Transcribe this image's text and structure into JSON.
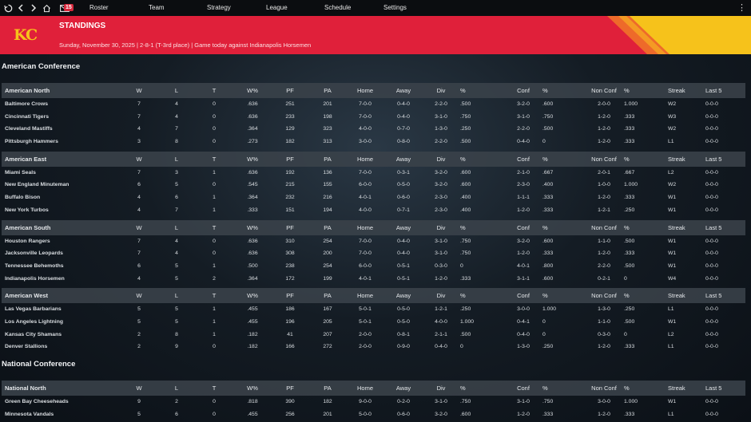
{
  "nav": {
    "mail_count": "15",
    "menu": [
      "Roster",
      "Team",
      "Strategy",
      "League",
      "Schedule",
      "Settings"
    ]
  },
  "header": {
    "logo_text": "KC",
    "title": "STANDINGS",
    "subtitle": "Sunday, November 30, 2025 | 2-8-1 (T-3rd place) | Game today against Indianapolis Horsemen",
    "colors": {
      "primary": "#e0203a",
      "accent": "#f6c21b"
    }
  },
  "columns": [
    "W",
    "L",
    "T",
    "W%",
    "PF",
    "PA",
    "Home",
    "Away",
    "Div",
    "%",
    "Conf",
    "%",
    "Non Conf",
    "%",
    "Streak",
    "Last 5"
  ],
  "conferences": [
    {
      "name": "American Conference",
      "divisions": [
        {
          "name": "American North",
          "rows": [
            [
              "Baltimore Crows",
              "7",
              "4",
              "0",
              ".636",
              "251",
              "201",
              "7-0-0",
              "0-4-0",
              "2-2-0",
              ".500",
              "3-2-0",
              ".600",
              "2-0-0",
              "1.000",
              "W2",
              "0-0-0"
            ],
            [
              "Cincinnati Tigers",
              "7",
              "4",
              "0",
              ".636",
              "233",
              "198",
              "7-0-0",
              "0-4-0",
              "3-1-0",
              ".750",
              "3-1-0",
              ".750",
              "1-2-0",
              ".333",
              "W3",
              "0-0-0"
            ],
            [
              "Cleveland Mastiffs",
              "4",
              "7",
              "0",
              ".364",
              "129",
              "323",
              "4-0-0",
              "0-7-0",
              "1-3-0",
              ".250",
              "2-2-0",
              ".500",
              "1-2-0",
              ".333",
              "W2",
              "0-0-0"
            ],
            [
              "Pittsburgh Hammers",
              "3",
              "8",
              "0",
              ".273",
              "182",
              "313",
              "3-0-0",
              "0-8-0",
              "2-2-0",
              ".500",
              "0-4-0",
              "0",
              "1-2-0",
              ".333",
              "L1",
              "0-0-0"
            ]
          ]
        },
        {
          "name": "American East",
          "rows": [
            [
              "Miami Seals",
              "7",
              "3",
              "1",
              ".636",
              "192",
              "136",
              "7-0-0",
              "0-3-1",
              "3-2-0",
              ".600",
              "2-1-0",
              ".667",
              "2-0-1",
              ".667",
              "L2",
              "0-0-0"
            ],
            [
              "New England Minuteman",
              "6",
              "5",
              "0",
              ".545",
              "215",
              "155",
              "6-0-0",
              "0-5-0",
              "3-2-0",
              ".600",
              "2-3-0",
              ".400",
              "1-0-0",
              "1.000",
              "W2",
              "0-0-0"
            ],
            [
              "Buffalo Bison",
              "4",
              "6",
              "1",
              ".364",
              "232",
              "216",
              "4-0-1",
              "0-6-0",
              "2-3-0",
              ".400",
              "1-1-1",
              ".333",
              "1-2-0",
              ".333",
              "W1",
              "0-0-0"
            ],
            [
              "New York Turbos",
              "4",
              "7",
              "1",
              ".333",
              "151",
              "194",
              "4-0-0",
              "0-7-1",
              "2-3-0",
              ".400",
              "1-2-0",
              ".333",
              "1-2-1",
              ".250",
              "W1",
              "0-0-0"
            ]
          ]
        },
        {
          "name": "American South",
          "rows": [
            [
              "Houston Rangers",
              "7",
              "4",
              "0",
              ".636",
              "310",
              "254",
              "7-0-0",
              "0-4-0",
              "3-1-0",
              ".750",
              "3-2-0",
              ".600",
              "1-1-0",
              ".500",
              "W1",
              "0-0-0"
            ],
            [
              "Jacksonville Leopards",
              "7",
              "4",
              "0",
              ".636",
              "308",
              "200",
              "7-0-0",
              "0-4-0",
              "3-1-0",
              ".750",
              "1-2-0",
              ".333",
              "1-2-0",
              ".333",
              "W1",
              "0-0-0"
            ],
            [
              "Tennessee Behemoths",
              "6",
              "5",
              "1",
              ".500",
              "238",
              "254",
              "6-0-0",
              "0-5-1",
              "0-3-0",
              "0",
              "4-0-1",
              ".800",
              "2-2-0",
              ".500",
              "W1",
              "0-0-0"
            ],
            [
              "Indianapolis Horsemen",
              "4",
              "5",
              "2",
              ".364",
              "172",
              "199",
              "4-0-1",
              "0-5-1",
              "1-2-0",
              ".333",
              "3-1-1",
              ".600",
              "0-2-1",
              "0",
              "W4",
              "0-0-0"
            ]
          ]
        },
        {
          "name": "American West",
          "rows": [
            [
              "Las Vegas Barbarians",
              "5",
              "5",
              "1",
              ".455",
              "186",
              "167",
              "5-0-1",
              "0-5-0",
              "1-2-1",
              ".250",
              "3-0-0",
              "1.000",
              "1-3-0",
              ".250",
              "L1",
              "0-0-0"
            ],
            [
              "Los Angeles Lightning",
              "5",
              "5",
              "1",
              ".455",
              "196",
              "205",
              "5-0-1",
              "0-5-0",
              "4-0-0",
              "1.000",
              "0-4-1",
              "0",
              "1-1-0",
              ".500",
              "W1",
              "0-0-0"
            ],
            [
              "Kansas City Shamans",
              "2",
              "8",
              "1",
              ".182",
              "41",
              "207",
              "2-0-0",
              "0-8-1",
              "2-1-1",
              ".500",
              "0-4-0",
              "0",
              "0-3-0",
              "0",
              "L2",
              "0-0-0"
            ],
            [
              "Denver Stallions",
              "2",
              "9",
              "0",
              ".182",
              "166",
              "272",
              "2-0-0",
              "0-9-0",
              "0-4-0",
              "0",
              "1-3-0",
              ".250",
              "1-2-0",
              ".333",
              "L1",
              "0-0-0"
            ]
          ]
        }
      ]
    },
    {
      "name": "National Conference",
      "divisions": [
        {
          "name": "National North",
          "rows": [
            [
              "Green Bay Cheeseheads",
              "9",
              "2",
              "0",
              ".818",
              "390",
              "182",
              "9-0-0",
              "0-2-0",
              "3-1-0",
              ".750",
              "3-1-0",
              ".750",
              "3-0-0",
              "1.000",
              "W1",
              "0-0-0"
            ],
            [
              "Minnesota Vandals",
              "5",
              "6",
              "0",
              ".455",
              "256",
              "201",
              "5-0-0",
              "0-6-0",
              "3-2-0",
              ".600",
              "1-2-0",
              ".333",
              "1-2-0",
              ".333",
              "L1",
              "0-0-0"
            ]
          ]
        }
      ]
    }
  ]
}
